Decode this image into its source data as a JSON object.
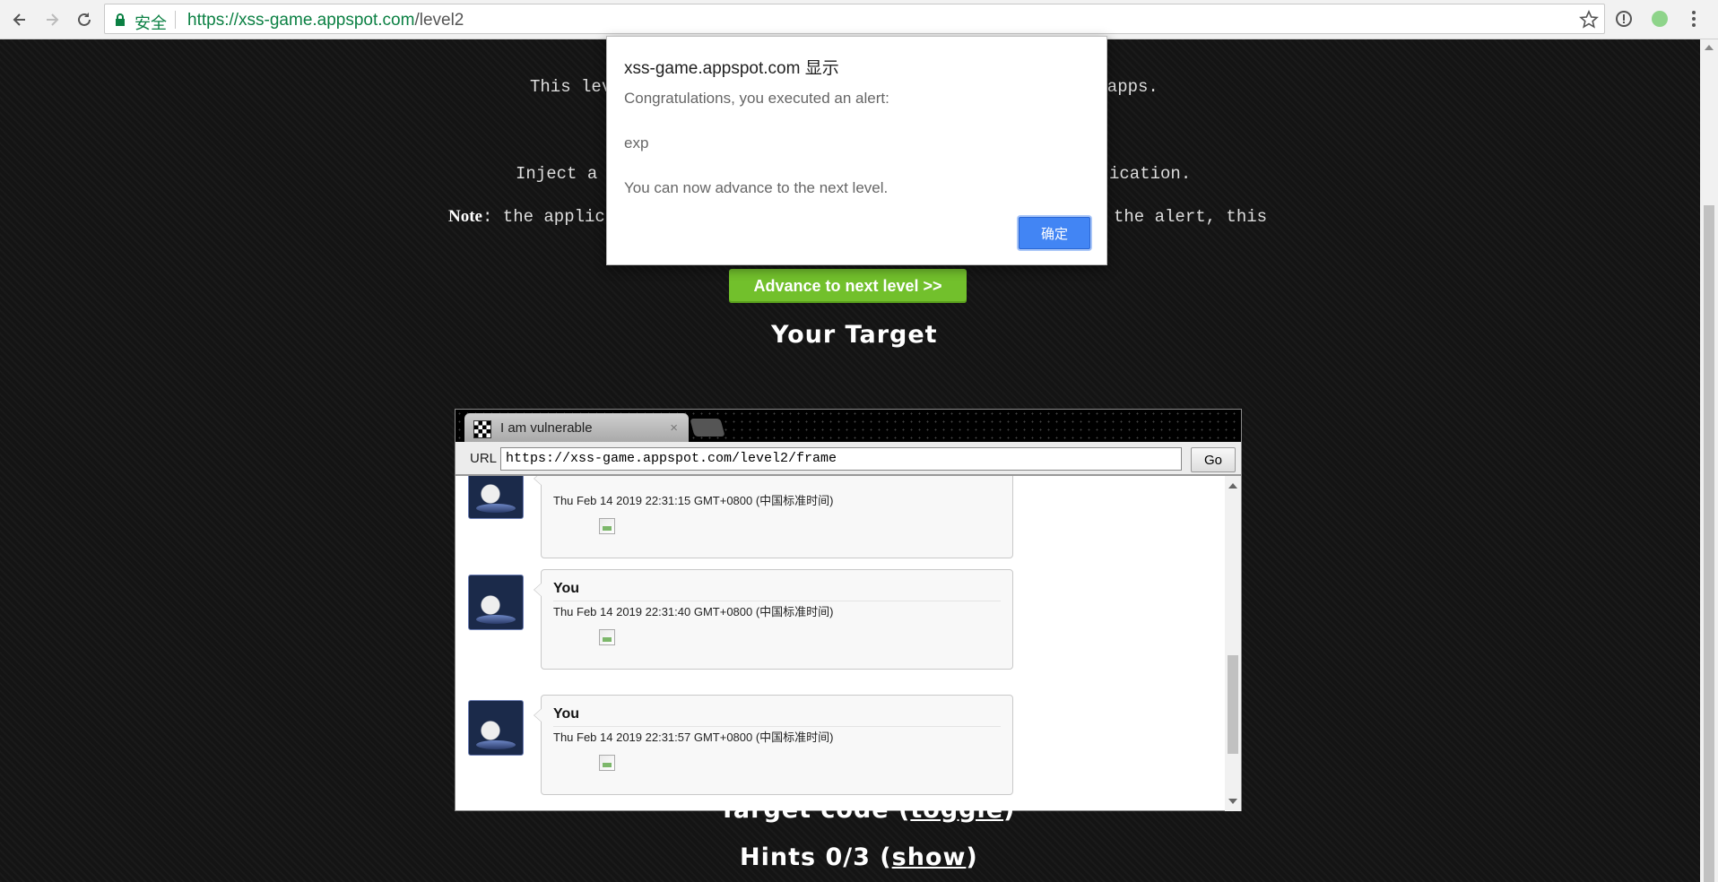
{
  "browser": {
    "secure_label": "安全",
    "url_host": "https://xss-game.appspot.com",
    "url_path": "/level2",
    "accent_color": "#0b8043"
  },
  "page": {
    "intro_left": "This leve",
    "intro_right": "k apps.",
    "task_left": "Inject a s",
    "task_right": "ication.",
    "note_bold": "Note",
    "note_left": ": the applica",
    "note_right": "the alert, this",
    "advance_button": "Advance to next level >>",
    "target_heading": "Your Target",
    "target_code_prefix": "Target code (",
    "target_code_link": "toggle",
    "target_code_suffix": ")",
    "hints_prefix": "Hints 0/3 (",
    "hints_link": "show",
    "hints_suffix": ")",
    "advance_color": "#72c02c"
  },
  "frame": {
    "tab_title": "I am vulnerable",
    "tab_close": "×",
    "url_label": "URL",
    "url_value": "https://xss-game.appspot.com/level2/frame",
    "go_button": "Go",
    "posts": [
      {
        "author": "",
        "date": "Thu Feb 14 2019 22:31:15 GMT+0800 (中国标准时间)"
      },
      {
        "author": "You",
        "date": "Thu Feb 14 2019 22:31:40 GMT+0800 (中国标准时间)"
      },
      {
        "author": "You",
        "date": "Thu Feb 14 2019 22:31:57 GMT+0800 (中国标准时间)"
      }
    ]
  },
  "alert": {
    "title": "xss-game.appspot.com 显示",
    "line1": "Congratulations, you executed an alert:",
    "line2": "exp",
    "line3": "You can now advance to the next level.",
    "ok_button": "确定",
    "ok_color": "#4285f4"
  }
}
